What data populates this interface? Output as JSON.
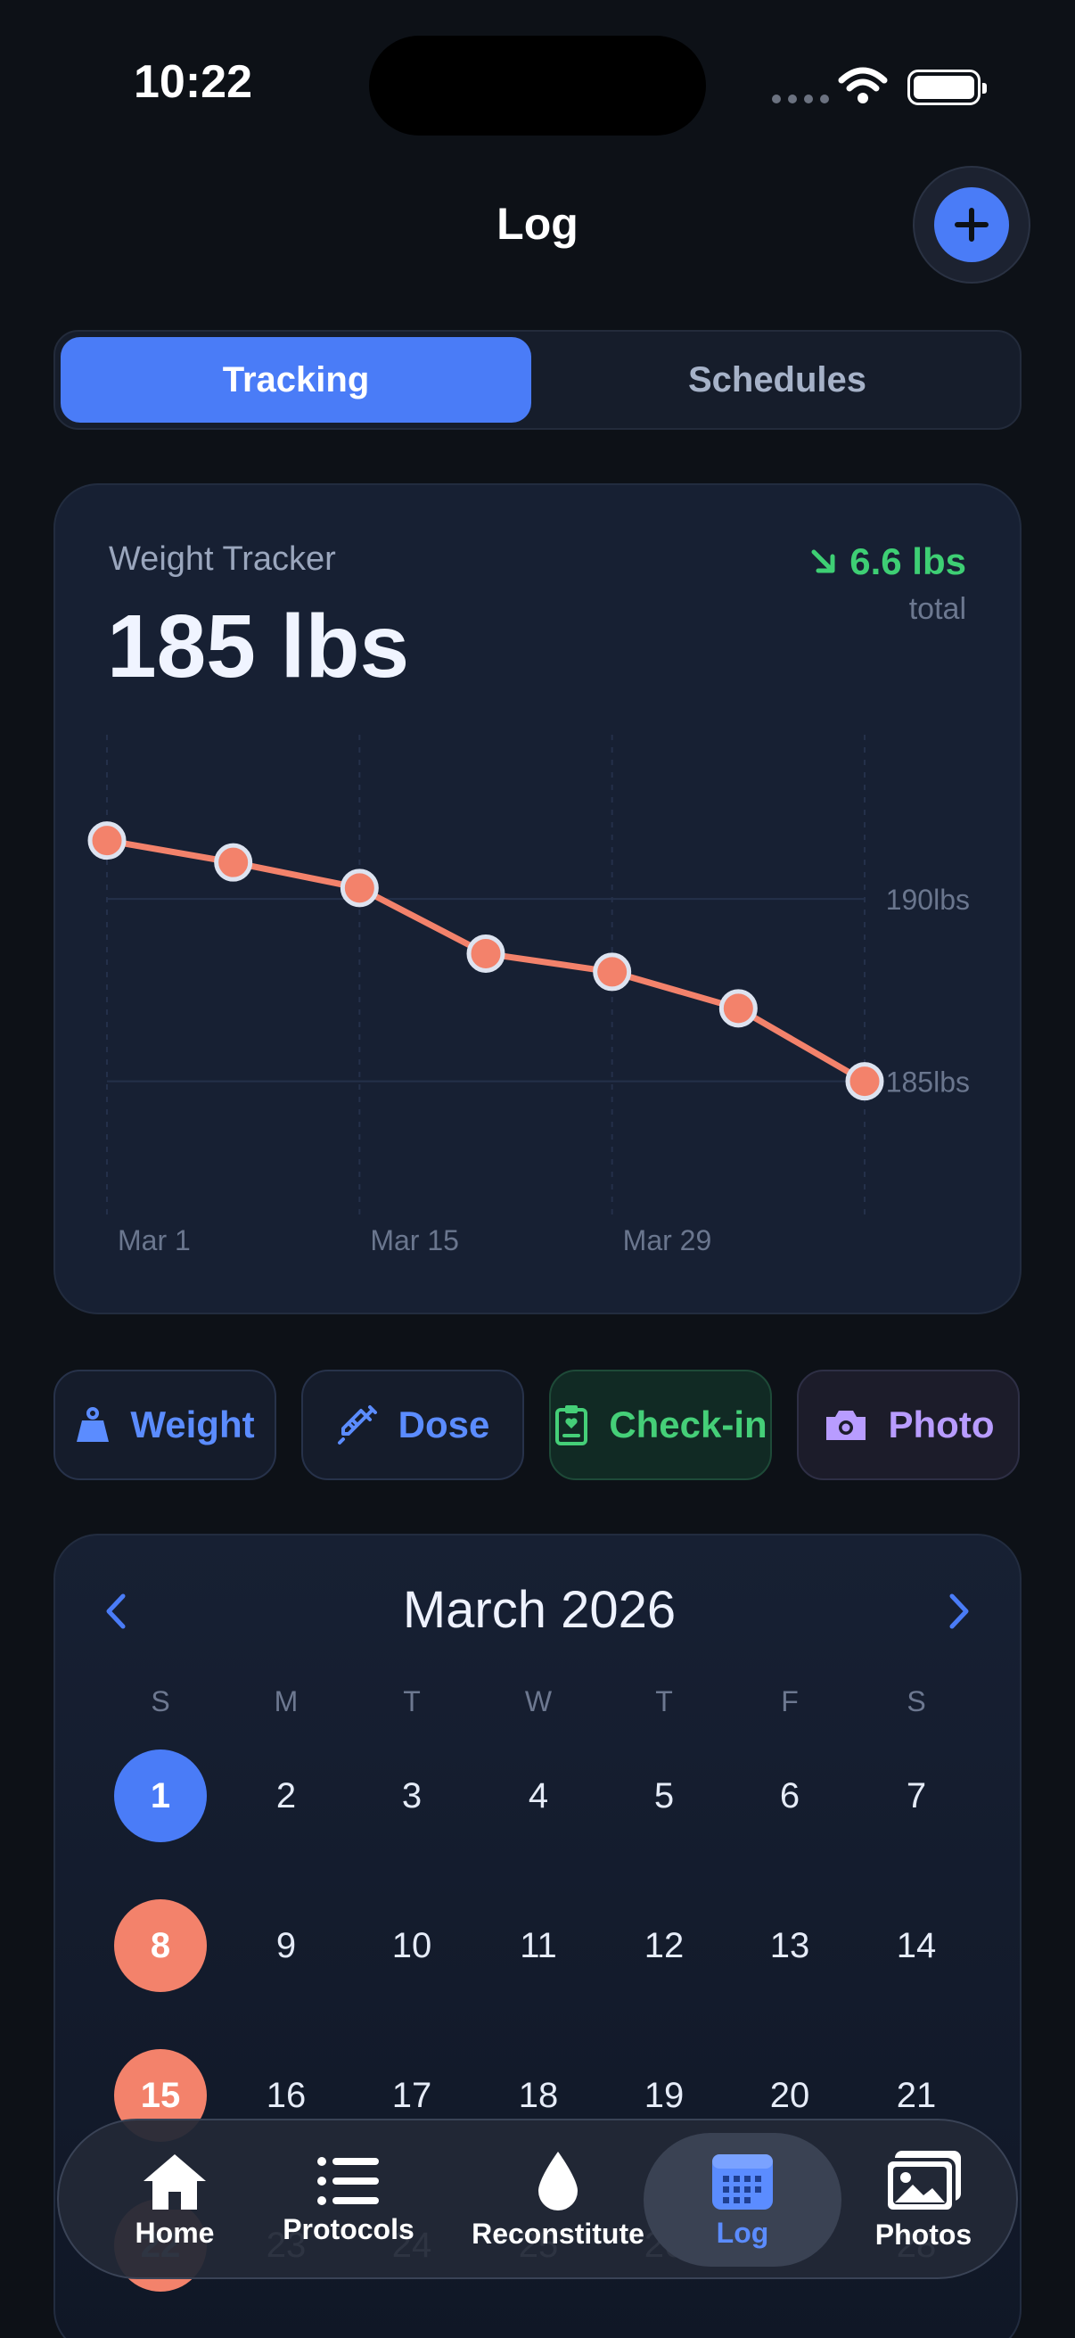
{
  "status": {
    "time": "10:22"
  },
  "header": {
    "title": "Log"
  },
  "segments": {
    "tracking": "Tracking",
    "schedules": "Schedules"
  },
  "weight_card": {
    "label": "Weight Tracker",
    "value": "185 lbs",
    "delta": "6.6 lbs",
    "delta_sub": "total",
    "accent": "#f3826b",
    "delta_color": "#3ecf74"
  },
  "chart_data": {
    "type": "line",
    "x": [
      "Mar 1",
      "Mar 8",
      "Mar 15",
      "Mar 22",
      "Mar 29",
      "Apr 5",
      "Apr 12"
    ],
    "x_tick_labels": [
      "Mar 1",
      "Mar 15",
      "Mar 29"
    ],
    "y_tick_labels": [
      "190lbs",
      "185lbs"
    ],
    "series": [
      {
        "values": [
          191.6,
          191.0,
          190.3,
          188.5,
          188.0,
          187.0,
          185.0
        ]
      }
    ],
    "ylim": [
      181.3,
      194.5
    ],
    "grid": true
  },
  "quick_actions": {
    "weight": "Weight",
    "dose": "Dose",
    "checkin": "Check-in",
    "photo": "Photo"
  },
  "calendar": {
    "month": "March 2026",
    "weekdays": [
      "S",
      "M",
      "T",
      "W",
      "T",
      "F",
      "S"
    ],
    "weeks": [
      [
        "1",
        "2",
        "3",
        "4",
        "5",
        "6",
        "7"
      ],
      [
        "8",
        "9",
        "10",
        "11",
        "12",
        "13",
        "14"
      ],
      [
        "15",
        "16",
        "17",
        "18",
        "19",
        "20",
        "21"
      ],
      [
        "22",
        "23",
        "24",
        "25",
        "26",
        "27",
        "28"
      ]
    ]
  },
  "tabs": {
    "home": "Home",
    "protocols": "Protocols",
    "reconstitute": "Reconstitute",
    "log": "Log",
    "photos": "Photos"
  }
}
